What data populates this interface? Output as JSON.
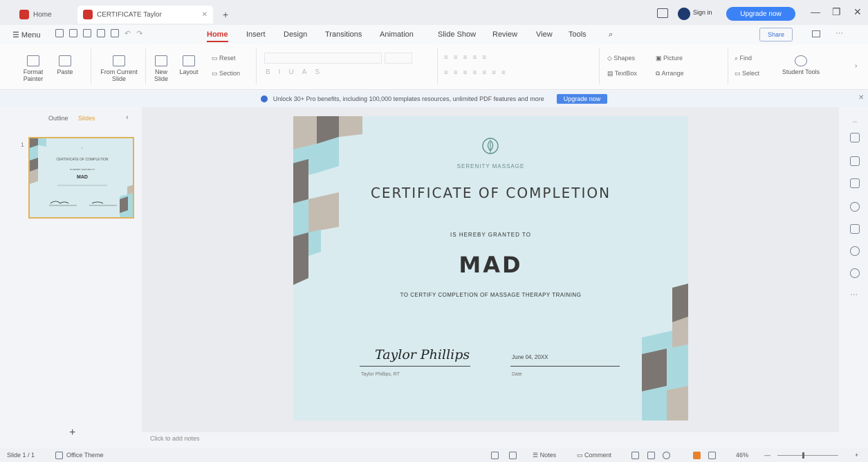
{
  "titlebar": {
    "home_tab": "Home",
    "doc_tab": "CERTIFICATE Taylor",
    "new_tab": "+",
    "sign_in": "Sign in",
    "upgrade": "Upgrade now",
    "minimize": "—",
    "restore": "❐",
    "close": "✕"
  },
  "menu": {
    "hamburger": "Menu",
    "items": [
      "Home",
      "Insert",
      "Design",
      "Transitions",
      "Animation",
      "Slide Show",
      "Review",
      "View",
      "Tools"
    ],
    "share": "Share"
  },
  "ribbon": {
    "format_painter": "Format Painter",
    "paste": "Paste",
    "from_current_slide": "From Current Slide",
    "new_slide": "New Slide",
    "layout": "Layout",
    "reset": "Reset",
    "section": "Section",
    "shapes": "Shapes",
    "picture": "Picture",
    "textbox": "TextBox",
    "arrange": "Arrange",
    "find": "Find",
    "select": "Select",
    "student_tools": "Student Tools"
  },
  "banner": {
    "text": "Unlock 30+ Pro benefits, including 100,000 templates resources, unlimited PDF features and more",
    "button": "Upgrade now"
  },
  "leftpanel": {
    "tab_outline": "Outline",
    "tab_slides": "Slides",
    "slide_number": "1",
    "add": "+"
  },
  "slide": {
    "brand": "SERENITY MASSAGE",
    "title": "CERTIFICATE OF COMPLETION",
    "granted": "IS HEREBY GRANTED TO",
    "recipient": "MAD",
    "certify": "TO CERTIFY COMPLETION OF MASSAGE THERAPY TRAINING",
    "signature": "Taylor Phillips",
    "signer": "Taylor Phillips, RT",
    "date": "June 04, 20XX",
    "date_label": "Date"
  },
  "notes": {
    "placeholder": "Click to add notes"
  },
  "statusbar": {
    "slide_info": "Slide 1 / 1",
    "theme": "Office Theme",
    "notes": "Notes",
    "comment": "Comment",
    "zoom": "46%"
  },
  "colors": {
    "accent": "#d0352d",
    "slide_bg": "#d9ebef",
    "teal": "#a9d9de",
    "gray_dark": "#7c7672",
    "beige": "#c4bcb0"
  }
}
